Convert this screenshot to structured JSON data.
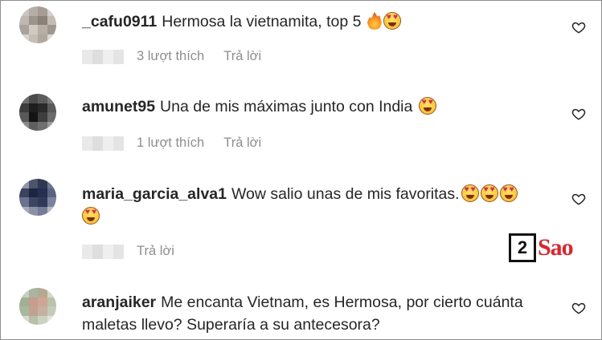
{
  "comments": [
    {
      "username": "_cafu0911",
      "text": "Hermosa la vietnamita, top 5",
      "emojis": [
        "fire-emoji",
        "heart-eyes-emoji"
      ],
      "likes": "3 lượt thích",
      "reply": "Trả lời",
      "avatar_colors": [
        "#c9c4be",
        "#b5aea6",
        "#a79c94",
        "#d3cec9",
        "#bdb8b0",
        "#9c938a",
        "#8a8178",
        "#c2bcb5",
        "#aaa39b",
        "#cfcac4",
        "#b8b0a6",
        "#9f968d",
        "#d8d4cf",
        "#c4beb7",
        "#b0a89f",
        "#dcd8d3"
      ]
    },
    {
      "username": "amunet95",
      "text": "Una de mis máximas junto con India",
      "emojis": [
        "heart-eyes-emoji"
      ],
      "likes": "1 lượt thích",
      "reply": "Trả lời",
      "avatar_colors": [
        "#6e6e6e",
        "#4a4a4a",
        "#5c5c5c",
        "#7c7c7c",
        "#3c3c3c",
        "#1e1e1e",
        "#2a2a2a",
        "#5a5a5a",
        "#585858",
        "#141414",
        "#3e3e3e",
        "#6a6a6a",
        "#8a8a8a",
        "#5f5f5f",
        "#707070",
        "#9a9a9a"
      ]
    },
    {
      "username": "maria_garcia_alva1",
      "text": "Wow salio unas de mis favoritas.",
      "emojis": [
        "heart-eyes-emoji",
        "heart-eyes-emoji",
        "heart-eyes-emoji",
        "heart-eyes-emoji"
      ],
      "likes": "",
      "reply": "Trả lời",
      "avatar_colors": [
        "#8e96a8",
        "#4c556c",
        "#2e3852",
        "#6c7590",
        "#3a4460",
        "#1c2640",
        "#253050",
        "#5a6380",
        "#6a7290",
        "#3c4562",
        "#303a58",
        "#7a839c",
        "#a3aabb",
        "#8a92a6",
        "#747d95",
        "#b2b8c6"
      ]
    },
    {
      "username": "aranjaiker",
      "text": "Me encanta Vietnam, es Hermosa, por cierto cuánta maletas llevo? Superaría a su antecesora?",
      "emojis": [],
      "likes": "",
      "reply": "",
      "avatar_colors": [
        "#c8cfc0",
        "#a8b5a0",
        "#b7a890",
        "#d9d4c8",
        "#9fb095",
        "#c79c8c",
        "#d0a593",
        "#b9c2ad",
        "#a8b89c",
        "#bfa292",
        "#c6b0a0",
        "#c3ccb8",
        "#d5dacd",
        "#b6c1a9",
        "#cbd2c0",
        "#e2e5dc"
      ]
    }
  ],
  "watermark": {
    "number": "2",
    "brand": "Sao"
  },
  "colors": {
    "username": "#262626",
    "meta": "#8e8e8e",
    "watermark_brand": "#e3232b"
  }
}
